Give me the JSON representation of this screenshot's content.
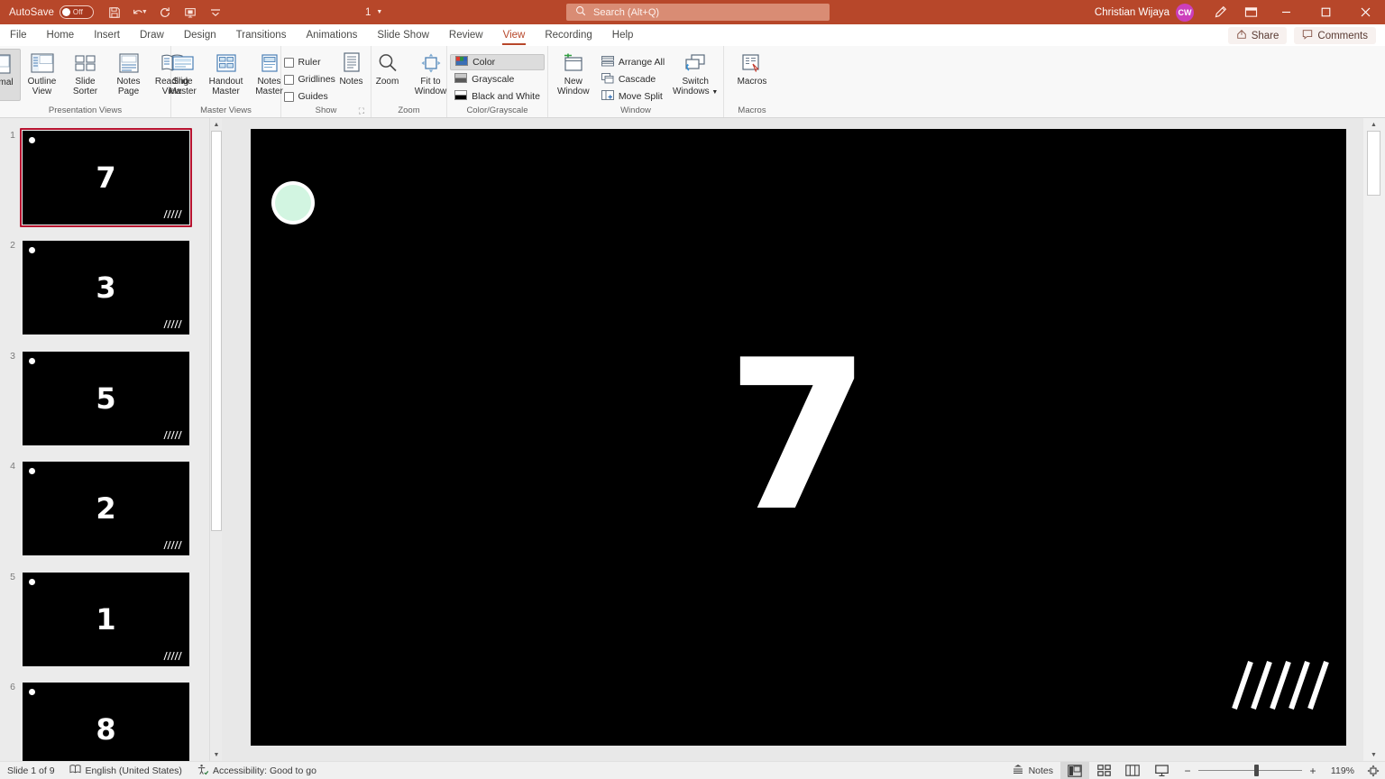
{
  "titlebar": {
    "autosave_label": "AutoSave",
    "autosave_state": "Off",
    "quick_access": [
      {
        "name": "save-icon",
        "glyph": "ὋE"
      },
      {
        "name": "undo-icon",
        "glyph": "↶"
      },
      {
        "name": "redo-icon",
        "glyph": "↻"
      },
      {
        "name": "start-from-beginning-icon",
        "glyph": "⬜"
      },
      {
        "name": "customize-quick-access-toolbar-icon",
        "glyph": "⌄"
      }
    ],
    "slide_indicator": "1",
    "search_placeholder": "Search (Alt+Q)",
    "user_name": "Christian Wijaya",
    "user_initials": "CW",
    "ink_icon_title": "Draw with Ink",
    "ribbon_display_icon_title": "Ribbon Display Options",
    "minimize": "–",
    "maximize": "☐",
    "close": "✕",
    "accent_color": "#b7472a",
    "avatar_color": "#cc3fbb"
  },
  "tabs": [
    {
      "label": "File",
      "active": false
    },
    {
      "label": "Home",
      "active": false
    },
    {
      "label": "Insert",
      "active": false
    },
    {
      "label": "Draw",
      "active": false
    },
    {
      "label": "Design",
      "active": false
    },
    {
      "label": "Transitions",
      "active": false
    },
    {
      "label": "Animations",
      "active": false
    },
    {
      "label": "Slide Show",
      "active": false
    },
    {
      "label": "Review",
      "active": false
    },
    {
      "label": "View",
      "active": true
    },
    {
      "label": "Recording",
      "active": false
    },
    {
      "label": "Help",
      "active": false
    }
  ],
  "tabstrip_right": {
    "share_label": "Share",
    "comments_label": "Comments"
  },
  "ribbon": {
    "groups": [
      {
        "name": "presentation-views",
        "label": "Presentation Views",
        "buttons": [
          {
            "label": "Normal",
            "selected": true
          },
          {
            "label": "Outline View",
            "selected": false
          },
          {
            "label": "Slide Sorter",
            "selected": false
          },
          {
            "label": "Notes Page",
            "selected": false
          },
          {
            "label": "Reading View",
            "selected": false
          }
        ]
      },
      {
        "name": "master-views",
        "label": "Master Views",
        "buttons": [
          {
            "label": "Slide Master",
            "selected": false
          },
          {
            "label": "Handout Master",
            "selected": false
          },
          {
            "label": "Notes Master",
            "selected": false
          }
        ]
      },
      {
        "name": "show",
        "label": "Show",
        "checkboxes": [
          {
            "label": "Ruler",
            "checked": false
          },
          {
            "label": "Gridlines",
            "checked": false
          },
          {
            "label": "Guides",
            "checked": false
          }
        ],
        "buttons": [
          {
            "label": "Notes",
            "selected": false
          }
        ],
        "has_dialog_launcher": true
      },
      {
        "name": "zoom",
        "label": "Zoom",
        "buttons": [
          {
            "label": "Zoom",
            "selected": false
          },
          {
            "label": "Fit to Window",
            "selected": false
          }
        ]
      },
      {
        "name": "color-grayscale",
        "label": "Color/Grayscale",
        "options": [
          {
            "label": "Color",
            "selected": true
          },
          {
            "label": "Grayscale",
            "selected": false
          },
          {
            "label": "Black and White",
            "selected": false
          }
        ]
      },
      {
        "name": "window",
        "label": "Window",
        "buttons": [
          {
            "label": "New Window",
            "selected": false
          },
          {
            "label": "Switch Windows",
            "selected": false,
            "has_caret": true
          }
        ],
        "small_buttons": [
          {
            "label": "Arrange All"
          },
          {
            "label": "Cascade"
          },
          {
            "label": "Move Split"
          }
        ]
      },
      {
        "name": "macros",
        "label": "Macros",
        "buttons": [
          {
            "label": "Macros",
            "selected": false
          }
        ]
      }
    ]
  },
  "slide_panel": {
    "thumbnails": [
      {
        "number": "1",
        "content": "7",
        "selected": true
      },
      {
        "number": "2",
        "content": "3",
        "selected": false
      },
      {
        "number": "3",
        "content": "5",
        "selected": false
      },
      {
        "number": "4",
        "content": "2",
        "selected": false
      },
      {
        "number": "5",
        "content": "1",
        "selected": false
      },
      {
        "number": "6",
        "content": "8",
        "selected": false
      }
    ],
    "selection_color": "#b7122f"
  },
  "slide": {
    "background_color": "#000000",
    "number_text": "7",
    "number_color": "#ffffff",
    "circle_color": "#d2f5e1",
    "circle_ring_color": "#ffffff",
    "slash_count": 5,
    "slash_color": "#ffffff"
  },
  "statusbar": {
    "slide_count_label": "Slide 1 of 9",
    "language": "English (United States)",
    "accessibility": "Accessibility: Good to go",
    "notes_label": "Notes",
    "views": [
      {
        "name": "normal-view",
        "active": true
      },
      {
        "name": "slide-sorter-view",
        "active": false
      },
      {
        "name": "reading-view",
        "active": false
      },
      {
        "name": "slide-show-view",
        "active": false
      }
    ],
    "zoom_out_label": "−",
    "zoom_in_label": "+",
    "zoom_percent": "119%",
    "fit_slide_title": "Fit slide to current window"
  }
}
